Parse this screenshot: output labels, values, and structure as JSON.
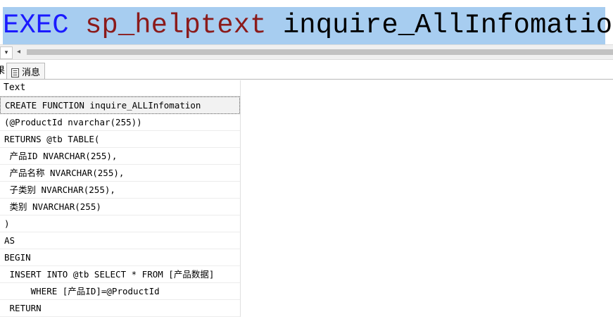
{
  "editor": {
    "keyword": "EXEC",
    "procedure": "sp_helptext",
    "argument": "inquire_AllInfomation"
  },
  "scrollbar": {
    "dropdown_glyph": "▾",
    "left_arrow_glyph": "◂"
  },
  "tabs": {
    "results_partial": "果",
    "messages_label": "消息",
    "messages_icon": "document-icon"
  },
  "grid": {
    "column_header": "Text",
    "rows": [
      "CREATE FUNCTION inquire_ALLInfomation",
      "(@ProductId nvarchar(255))",
      "RETURNS @tb TABLE(",
      " 产品ID NVARCHAR(255),",
      " 产品名称 NVARCHAR(255),",
      " 子类别 NVARCHAR(255),",
      " 类别 NVARCHAR(255)",
      ")",
      "AS",
      "BEGIN",
      " INSERT INTO @tb SELECT * FROM [产品数据]",
      "     WHERE [产品ID]=@ProductId",
      " RETURN"
    ]
  },
  "colors": {
    "editor_selection": "#a7cdf0",
    "keyword": "#1a1aff",
    "procedure": "#8b1a1a"
  }
}
